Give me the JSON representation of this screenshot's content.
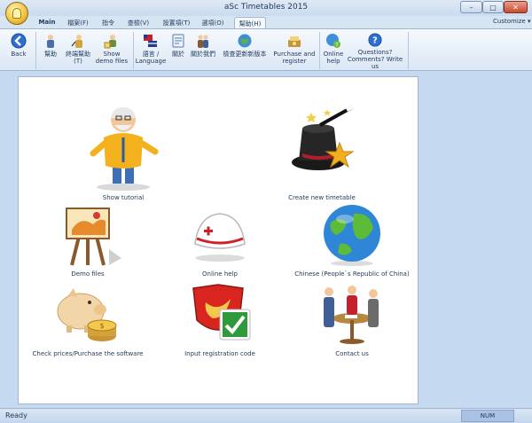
{
  "window": {
    "title": "aSc Timetables 2015",
    "customize": "Customize"
  },
  "menu": {
    "tabs": [
      {
        "label": "Main"
      },
      {
        "label": "檔案(F)"
      },
      {
        "label": "指令"
      },
      {
        "label": "查檢(V)"
      },
      {
        "label": "設置項(T)"
      },
      {
        "label": "選項(O)"
      },
      {
        "label": "幫助(H)"
      }
    ],
    "active_index": 6
  },
  "ribbon": {
    "buttons": [
      {
        "label": "Back",
        "icon": "back-arrow-icon"
      },
      {
        "label": "幫助",
        "icon": "teacher-icon"
      },
      {
        "label": "終端幫助(T)",
        "icon": "help-teacher-icon"
      },
      {
        "label": "Show demo files",
        "icon": "demo-files-icon"
      },
      {
        "label": "語言 / Language",
        "icon": "language-flags-icon"
      },
      {
        "label": "關於",
        "icon": "about-icon"
      },
      {
        "label": "關於我們",
        "icon": "people-icon"
      },
      {
        "label": "檢查更新新版本",
        "icon": "globe-update-icon"
      },
      {
        "label": "Purchase and register",
        "icon": "purchase-icon"
      },
      {
        "label": "Online help",
        "icon": "online-help-icon"
      },
      {
        "label": "Questions? Comments? Write us",
        "icon": "question-icon"
      }
    ]
  },
  "cards": [
    {
      "label": "Show tutorial",
      "icon": "professor-icon"
    },
    {
      "label": "Create new timetable",
      "icon": "magic-hat-icon"
    },
    {
      "label": "Demo files",
      "icon": "easel-icon"
    },
    {
      "label": "Online help",
      "icon": "nurse-cap-icon"
    },
    {
      "label": "Chinese (People`s Republic of China)",
      "icon": "globe-icon"
    },
    {
      "label": "Check prices/Purchase the software",
      "icon": "piggy-bank-icon"
    },
    {
      "label": "Input registration code",
      "icon": "shield-check-icon"
    },
    {
      "label": "Contact us",
      "icon": "meeting-icon"
    }
  ],
  "status": {
    "text": "Ready",
    "num": "NUM"
  }
}
